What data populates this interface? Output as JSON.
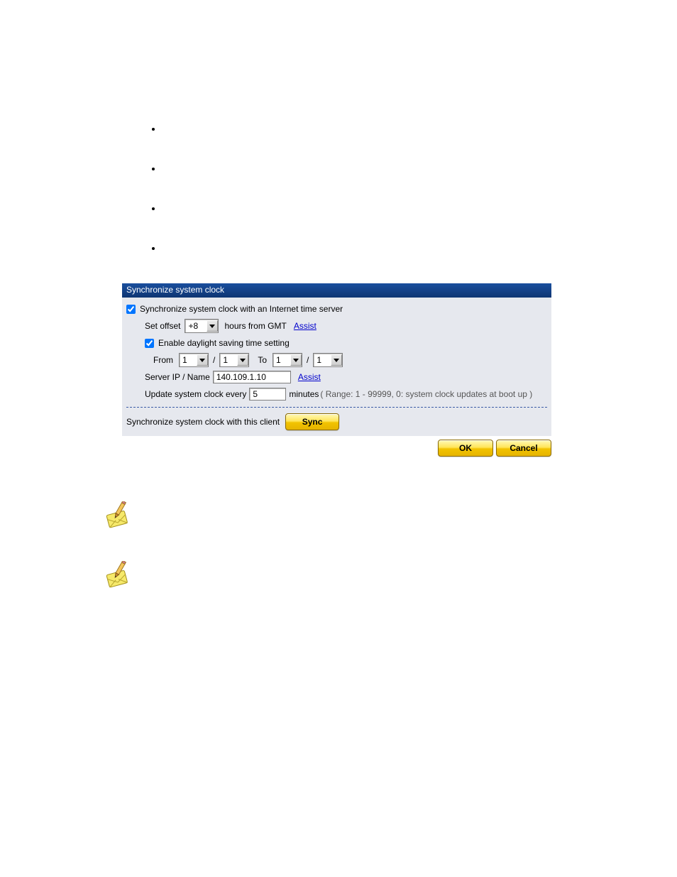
{
  "bullets": {
    "count": 4
  },
  "panel": {
    "title": "Synchronize system clock",
    "sync_internet_label": "Synchronize system clock with an Internet time server",
    "sync_internet_checked": true,
    "offset": {
      "prefix": "Set offset",
      "value": "+8",
      "suffix": "hours from GMT",
      "assist": "Assist"
    },
    "dst": {
      "enable_label": "Enable daylight saving time setting",
      "enable_checked": true,
      "from_label": "From",
      "from_month": "1",
      "from_day": "1",
      "to_label": "To",
      "to_month": "1",
      "to_day": "1"
    },
    "server": {
      "label": "Server  IP / Name",
      "value": "140.109.1.10",
      "assist": "Assist"
    },
    "update": {
      "prefix": "Update system clock every",
      "value": "5",
      "unit": "minutes",
      "range": "( Range: 1 - 99999, 0: system clock updates at boot up )"
    },
    "sync_client_label": "Synchronize system clock with this client",
    "sync_button": "Sync",
    "ok": "OK",
    "cancel": "Cancel"
  }
}
